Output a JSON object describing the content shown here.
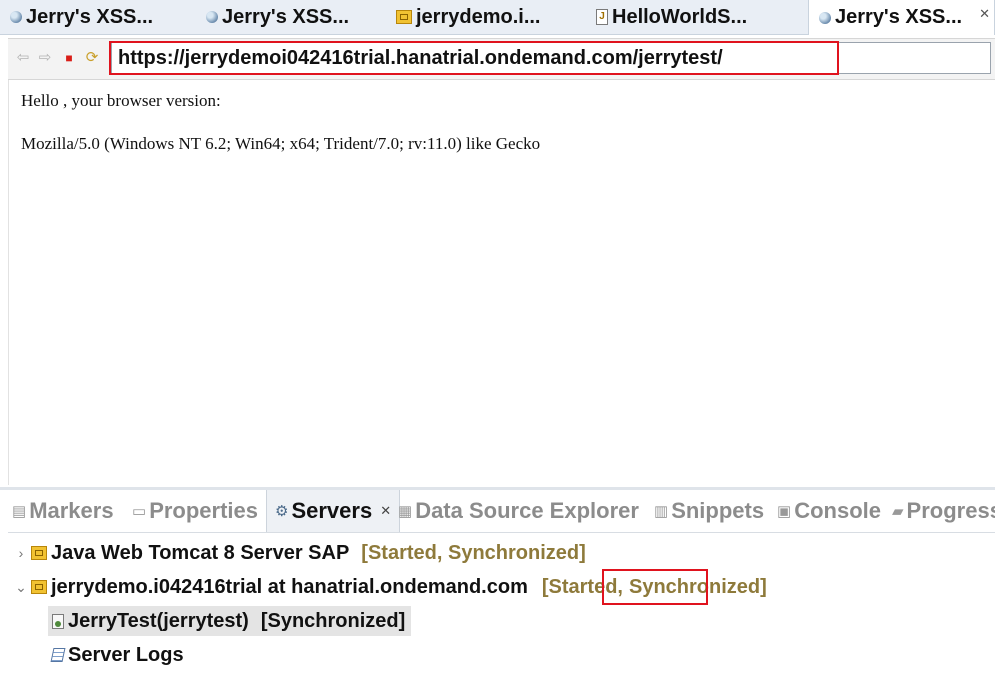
{
  "editor_tabs": [
    {
      "label": "Jerry's XSS...",
      "icon": "globe-icon"
    },
    {
      "label": "Jerry's XSS...",
      "icon": "globe-icon"
    },
    {
      "label": "jerrydemo.i...",
      "icon": "server-package-icon"
    },
    {
      "label": "HelloWorldS...",
      "icon": "java-file-icon"
    },
    {
      "label": "Jerry's XSS...",
      "icon": "globe-icon",
      "active": true
    }
  ],
  "browser": {
    "url": "https://jerrydemoi042416trial.hanatrial.ondemand.com/jerrytest/",
    "nav_icons": [
      "back-arrow-icon",
      "forward-arrow-icon",
      "stop-icon",
      "refresh-icon"
    ]
  },
  "page": {
    "line1": "Hello , your browser version:",
    "line2": "Mozilla/5.0 (Windows NT 6.2; Win64; x64; Trident/7.0; rv:11.0) like Gecko"
  },
  "view_tabs": [
    {
      "label": "Markers",
      "icon": "markers-icon"
    },
    {
      "label": "Properties",
      "icon": "properties-icon"
    },
    {
      "label": "Servers",
      "icon": "servers-icon",
      "active": true
    },
    {
      "label": "Data Source Explorer",
      "icon": "data-source-icon"
    },
    {
      "label": "Snippets",
      "icon": "snippets-icon"
    },
    {
      "label": "Console",
      "icon": "console-icon"
    },
    {
      "label": "Progress",
      "icon": "progress-icon"
    }
  ],
  "servers": {
    "tomcat": {
      "name": "Java Web Tomcat 8 Server SAP",
      "status": "[Started, Synchronized]",
      "expanded": false
    },
    "hana": {
      "name": "jerrydemo.i042416trial at hanatrial.ondemand.com",
      "status_a": "[Started,",
      "status_b": "Synchronized]",
      "expanded": true
    },
    "module": {
      "name": "JerryTest(jerrytest)",
      "status": "[Synchronized]"
    },
    "logs": {
      "name": "Server Logs"
    }
  },
  "colors": {
    "highlight": "#e0131e",
    "status": "#8e7a3b"
  }
}
